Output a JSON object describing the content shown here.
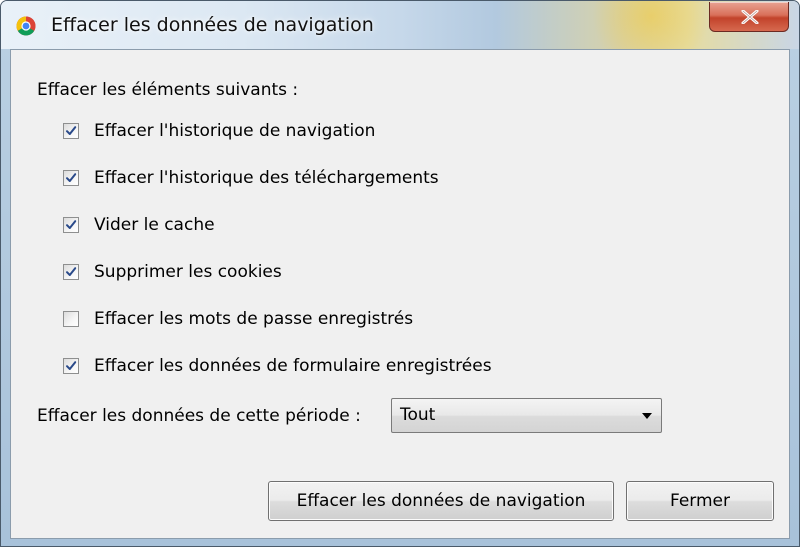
{
  "window": {
    "title": "Effacer les données de navigation",
    "close_icon": "close-icon",
    "app_icon": "chrome-icon"
  },
  "dialog": {
    "heading": "Effacer les éléments suivants :",
    "options": [
      {
        "label": "Effacer l'historique de navigation",
        "checked": true
      },
      {
        "label": "Effacer l'historique des téléchargements",
        "checked": true
      },
      {
        "label": "Vider le cache",
        "checked": true
      },
      {
        "label": "Supprimer les cookies",
        "checked": true
      },
      {
        "label": "Effacer les mots de passe enregistrés",
        "checked": false
      },
      {
        "label": "Effacer les données de formulaire enregistrées",
        "checked": true
      }
    ],
    "period_label": "Effacer les données de cette période :",
    "period_select": {
      "value": "Tout"
    }
  },
  "buttons": {
    "clear_label": "Effacer les données de navigation",
    "close_label": "Fermer"
  }
}
